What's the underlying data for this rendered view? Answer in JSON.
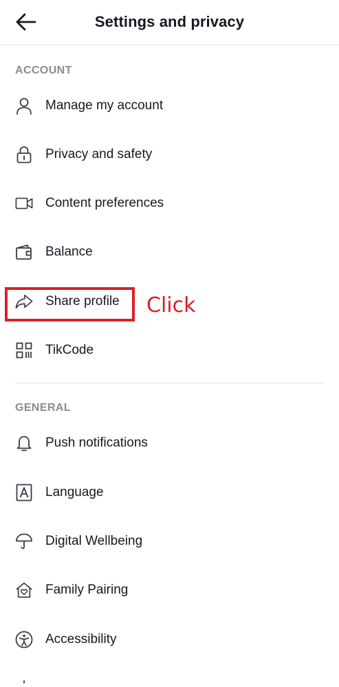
{
  "header": {
    "title": "Settings and privacy",
    "back_icon": "arrow-left-icon"
  },
  "sections": {
    "account": {
      "title": "ACCOUNT",
      "items": [
        {
          "label": "Manage my account",
          "icon": "person-icon"
        },
        {
          "label": "Privacy and safety",
          "icon": "lock-icon"
        },
        {
          "label": "Content preferences",
          "icon": "video-camera-icon"
        },
        {
          "label": "Balance",
          "icon": "wallet-icon"
        },
        {
          "label": "Share profile",
          "icon": "share-arrow-icon"
        },
        {
          "label": "TikCode",
          "icon": "qr-code-icon"
        }
      ]
    },
    "general": {
      "title": "GENERAL",
      "items": [
        {
          "label": "Push notifications",
          "icon": "bell-icon"
        },
        {
          "label": "Language",
          "icon": "letter-a-icon"
        },
        {
          "label": "Digital Wellbeing",
          "icon": "umbrella-icon"
        },
        {
          "label": "Family Pairing",
          "icon": "house-heart-icon"
        },
        {
          "label": "Accessibility",
          "icon": "accessibility-icon"
        }
      ]
    }
  },
  "annotation": {
    "label": "Click",
    "color": "#d92027"
  },
  "colors": {
    "text_primary": "#161823",
    "section_header": "#8a8b91",
    "divider": "#e3e3e4"
  }
}
